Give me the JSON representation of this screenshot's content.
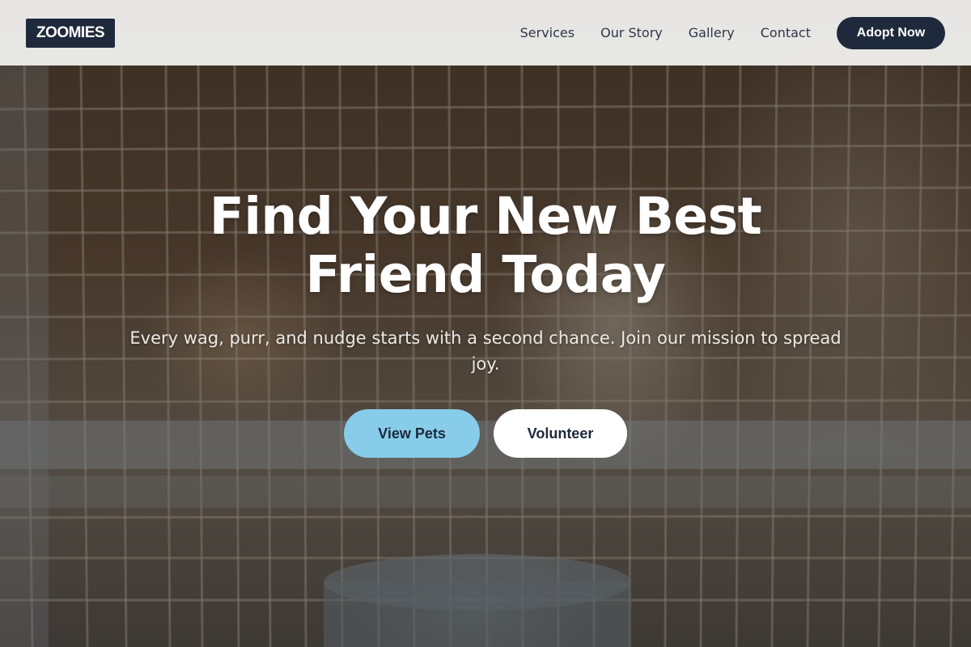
{
  "nav": {
    "logo": "ZOOMIES",
    "links": [
      "Services",
      "Our Story",
      "Gallery",
      "Contact"
    ],
    "cta_label": "Adopt Now"
  },
  "hero": {
    "headline_line1": "Find Your New Best",
    "headline_line2": "Friend Today",
    "subtitle": "Every wag, purr, and nudge starts with a second chance. Join our mission to spread joy.",
    "buttons": {
      "view_pets": "View Pets",
      "volunteer": "Volunteer"
    },
    "background_image": "dogs-behind-cage-photo"
  },
  "colors": {
    "brand_dark": "#1e293b",
    "accent_light_blue": "#87cce9",
    "nav_background": "#f2f2f0",
    "white": "#ffffff"
  }
}
